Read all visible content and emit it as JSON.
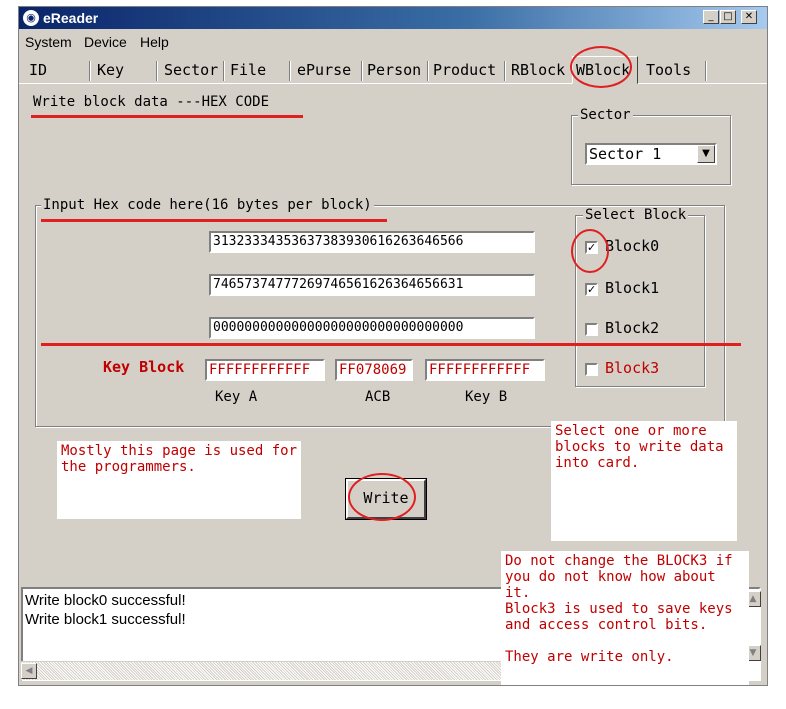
{
  "window": {
    "title": "eReader",
    "icon": "reader-icon"
  },
  "menu": [
    "System",
    "Device",
    "Help"
  ],
  "tabs": [
    "ID",
    "Key",
    "Sector",
    "File",
    "ePurse",
    "Person",
    "Product",
    "RBlock",
    "WBlock",
    "Tools"
  ],
  "active_tab": "WBlock",
  "heading": "Write block data ---HEX CODE",
  "sector": {
    "label": "Sector",
    "selected": "Sector 1"
  },
  "input_group": {
    "label": "Input Hex code here(16 bytes per block)",
    "rows": [
      "31323334353637383930616263646566",
      "74657374777269746561626364656631",
      "00000000000000000000000000000000"
    ]
  },
  "select_block": {
    "label": "Select Block",
    "items": [
      {
        "label": "Block0",
        "checked": true
      },
      {
        "label": "Block1",
        "checked": true
      },
      {
        "label": "Block2",
        "checked": false
      },
      {
        "label": "Block3",
        "checked": false
      }
    ]
  },
  "key_block": {
    "label": "Key Block",
    "key_a": "FFFFFFFFFFFF",
    "acb": "FF078069",
    "key_b": "FFFFFFFFFFFF",
    "key_a_caption": "Key A",
    "acb_caption": "ACB",
    "key_b_caption": "Key B"
  },
  "write_button": "Write",
  "notes": {
    "programmers": "Mostly this page is used for the programmers.",
    "select_blocks": "Select one or more blocks to write data into card.",
    "block3_warning_1": "Do not change the BLOCK3 if you do not know how about it.",
    "block3_warning_2": "Block3 is used to save keys and access control bits.",
    "block3_warning_3": "They are write only."
  },
  "log": [
    "Write block0 successful!",
    "Write block1 successful!"
  ],
  "colors": {
    "annotation": "#e02020",
    "note_text": "#c00000",
    "window_bg": "#d4d0c8"
  }
}
